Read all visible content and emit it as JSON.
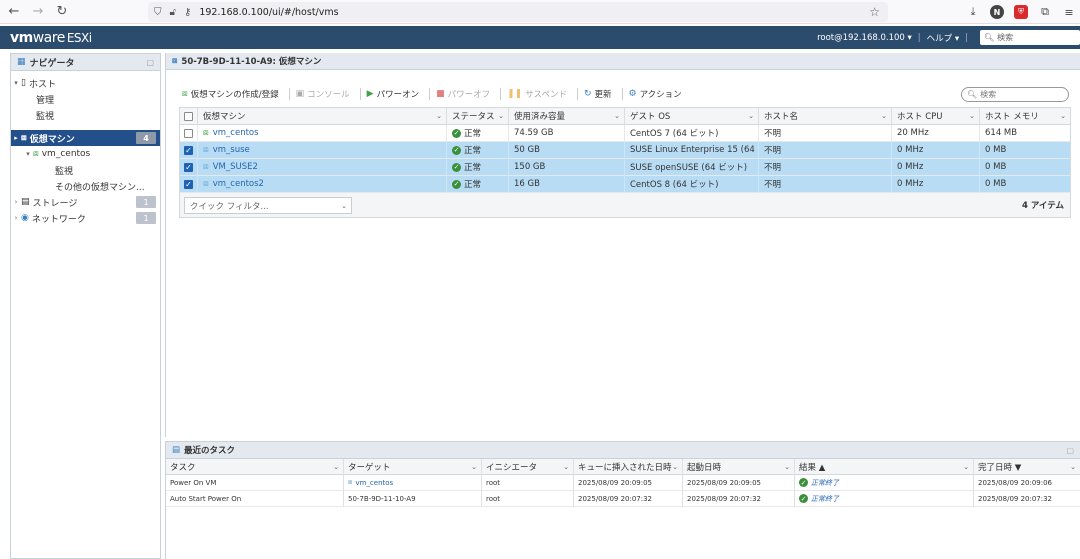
{
  "browser": {
    "url": "192.168.0.100/ui/#/host/vms"
  },
  "header": {
    "brand": "vm",
    "brand_rest": "ware",
    "product": "ESXi",
    "user": "root@192.168.0.100 ▾",
    "help": "ヘルプ ▾",
    "search_placeholder": "検索"
  },
  "navigator": {
    "title": "ナビゲータ",
    "items": [
      {
        "label": "ホスト",
        "badge": ""
      },
      {
        "label": "管理",
        "badge": ""
      },
      {
        "label": "監視",
        "badge": ""
      },
      {
        "label": "仮想マシン",
        "badge": "4"
      },
      {
        "label": "vm_centos",
        "badge": ""
      },
      {
        "label": "監視",
        "badge": ""
      },
      {
        "label": "その他の仮想マシン...",
        "badge": ""
      },
      {
        "label": "ストレージ",
        "badge": "1"
      },
      {
        "label": "ネットワーク",
        "badge": "1"
      }
    ]
  },
  "main": {
    "title": "50-7B-9D-11-10-A9: 仮想マシン",
    "toolbar": {
      "create": "仮想マシンの作成/登録",
      "console": "コンソール",
      "power_on": "パワーオン",
      "power_off": "パワーオフ",
      "suspend": "サスペンド",
      "refresh": "更新",
      "actions": "アクション"
    },
    "search_placeholder": "検索",
    "columns": [
      "仮想マシン",
      "ステータス",
      "使用済み容量",
      "ゲスト OS",
      "ホスト名",
      "ホスト CPU",
      "ホスト メモリ"
    ],
    "rows": [
      {
        "checked": false,
        "name": "vm_centos",
        "status": "正常",
        "used": "74.59 GB",
        "os": "CentOS 7 (64 ビット)",
        "host": "不明",
        "cpu": "20 MHz",
        "mem": "614 MB"
      },
      {
        "checked": true,
        "name": "vm_suse",
        "status": "正常",
        "used": "50 GB",
        "os": "SUSE Linux Enterprise 15 (64 ...",
        "host": "不明",
        "cpu": "0 MHz",
        "mem": "0 MB"
      },
      {
        "checked": true,
        "name": "VM_SUSE2",
        "status": "正常",
        "used": "150 GB",
        "os": "SUSE openSUSE (64 ビット)",
        "host": "不明",
        "cpu": "0 MHz",
        "mem": "0 MB"
      },
      {
        "checked": true,
        "name": "vm_centos2",
        "status": "正常",
        "used": "16 GB",
        "os": "CentOS 8 (64 ビット)",
        "host": "不明",
        "cpu": "0 MHz",
        "mem": "0 MB"
      }
    ],
    "quick_filter": "クイック フィルタ...",
    "item_count": "4 アイテム"
  },
  "tasks": {
    "title": "最近のタスク",
    "columns": [
      "タスク",
      "ターゲット",
      "イニシエータ",
      "キューに挿入された日時",
      "起動日時",
      "結果 ▲",
      "完了日時 ▼"
    ],
    "rows": [
      {
        "task": "Power On VM",
        "target": "vm_centos",
        "initiator": "root",
        "queued": "2025/08/09 20:09:05",
        "started": "2025/08/09 20:09:05",
        "result": "正常終了",
        "completed": "2025/08/09 20:09:06"
      },
      {
        "task": "Auto Start Power On",
        "target": "50-7B-9D-11-10-A9",
        "initiator": "root",
        "queued": "2025/08/09 20:07:32",
        "started": "2025/08/09 20:07:32",
        "result": "正常終了",
        "completed": "2025/08/09 20:07:32"
      }
    ]
  }
}
